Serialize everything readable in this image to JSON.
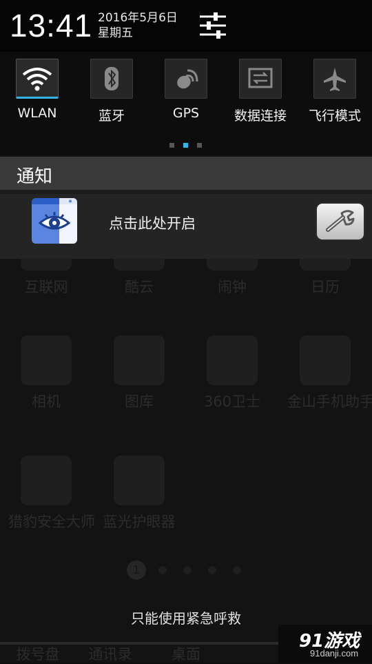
{
  "status_bar": {
    "time": "13:41",
    "date": "2016年5月6日",
    "weekday": "星期五"
  },
  "quick_settings": {
    "tiles": [
      {
        "label": "WLAN",
        "icon": "wifi-icon",
        "active": true
      },
      {
        "label": "蓝牙",
        "icon": "bluetooth-icon",
        "active": false
      },
      {
        "label": "GPS",
        "icon": "gps-icon",
        "active": false
      },
      {
        "label": "数据连接",
        "icon": "data-connection-icon",
        "active": false
      },
      {
        "label": "飞行模式",
        "icon": "airplane-icon",
        "active": false
      }
    ],
    "page_indicator": {
      "count": 3,
      "active_index": 1
    }
  },
  "notifications": {
    "header": "通知",
    "items": [
      {
        "text": "点击此处开启",
        "app_icon": "eye-protection-icon",
        "action_icon": "wrench-icon"
      }
    ]
  },
  "launcher_background": {
    "apps": [
      "互联网",
      "酷云",
      "闹钟",
      "日历",
      "相机",
      "图库",
      "360卫士",
      "金山手机助手",
      "猎豹安全大师",
      "蓝光护眼器"
    ],
    "page_current": "1",
    "dock": [
      "拨号盘",
      "通讯录",
      "桌面"
    ]
  },
  "lockscreen": {
    "emergency_text": "只能使用紧急呼救"
  },
  "watermark": {
    "logo": "91游戏",
    "url": "91danji.com"
  },
  "colors": {
    "accent": "#33b5e5",
    "notification_header_bg": "#3a3a3a",
    "notification_item_bg": "#242424"
  }
}
